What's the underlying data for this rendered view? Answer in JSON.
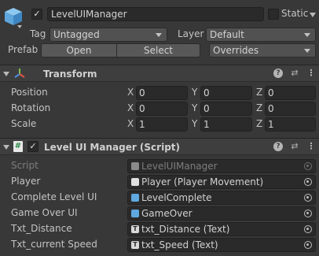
{
  "gameobject": {
    "name": "LevelUIManager",
    "static_label": "Static",
    "tag_label": "Tag",
    "tag_value": "Untagged",
    "layer_label": "Layer",
    "layer_value": "Default",
    "prefab_label": "Prefab",
    "open_label": "Open",
    "select_label": "Select",
    "overrides_label": "Overrides",
    "active": true,
    "static": false
  },
  "transform": {
    "title": "Transform",
    "rows": [
      {
        "label": "Position",
        "x": "0",
        "y": "0",
        "z": "0"
      },
      {
        "label": "Rotation",
        "x": "0",
        "y": "0",
        "z": "0"
      },
      {
        "label": "Scale",
        "x": "1",
        "y": "1",
        "z": "1"
      }
    ],
    "axis_x": "X",
    "axis_y": "Y",
    "axis_z": "Z"
  },
  "script_component": {
    "title": "Level UI Manager (Script)",
    "enabled": true,
    "fields": [
      {
        "label": "Script",
        "value": "LevelUIManager",
        "icon": "script-icon",
        "disabled": true
      },
      {
        "label": "Player",
        "value": "Player (Player Movement)",
        "icon": "script-icon",
        "disabled": false
      },
      {
        "label": "Complete Level UI",
        "value": "LevelComplete",
        "icon": "prefab-icon",
        "disabled": false
      },
      {
        "label": "Game Over UI",
        "value": "GameOver",
        "icon": "prefab-icon",
        "disabled": false
      },
      {
        "label": "Txt_Distance",
        "value": "txt_Distance (Text)",
        "icon": "text-icon",
        "disabled": false
      },
      {
        "label": "Txt_current Speed",
        "value": "txt_Speed (Text)",
        "icon": "text-icon",
        "disabled": false
      }
    ]
  },
  "colors": {
    "background": "#383838",
    "field": "#2a2a2a",
    "prefab_blue": "#5fa8e0",
    "axis_red": "#e0574a",
    "axis_green": "#7ec14e",
    "axis_blue": "#4e8ee0"
  }
}
